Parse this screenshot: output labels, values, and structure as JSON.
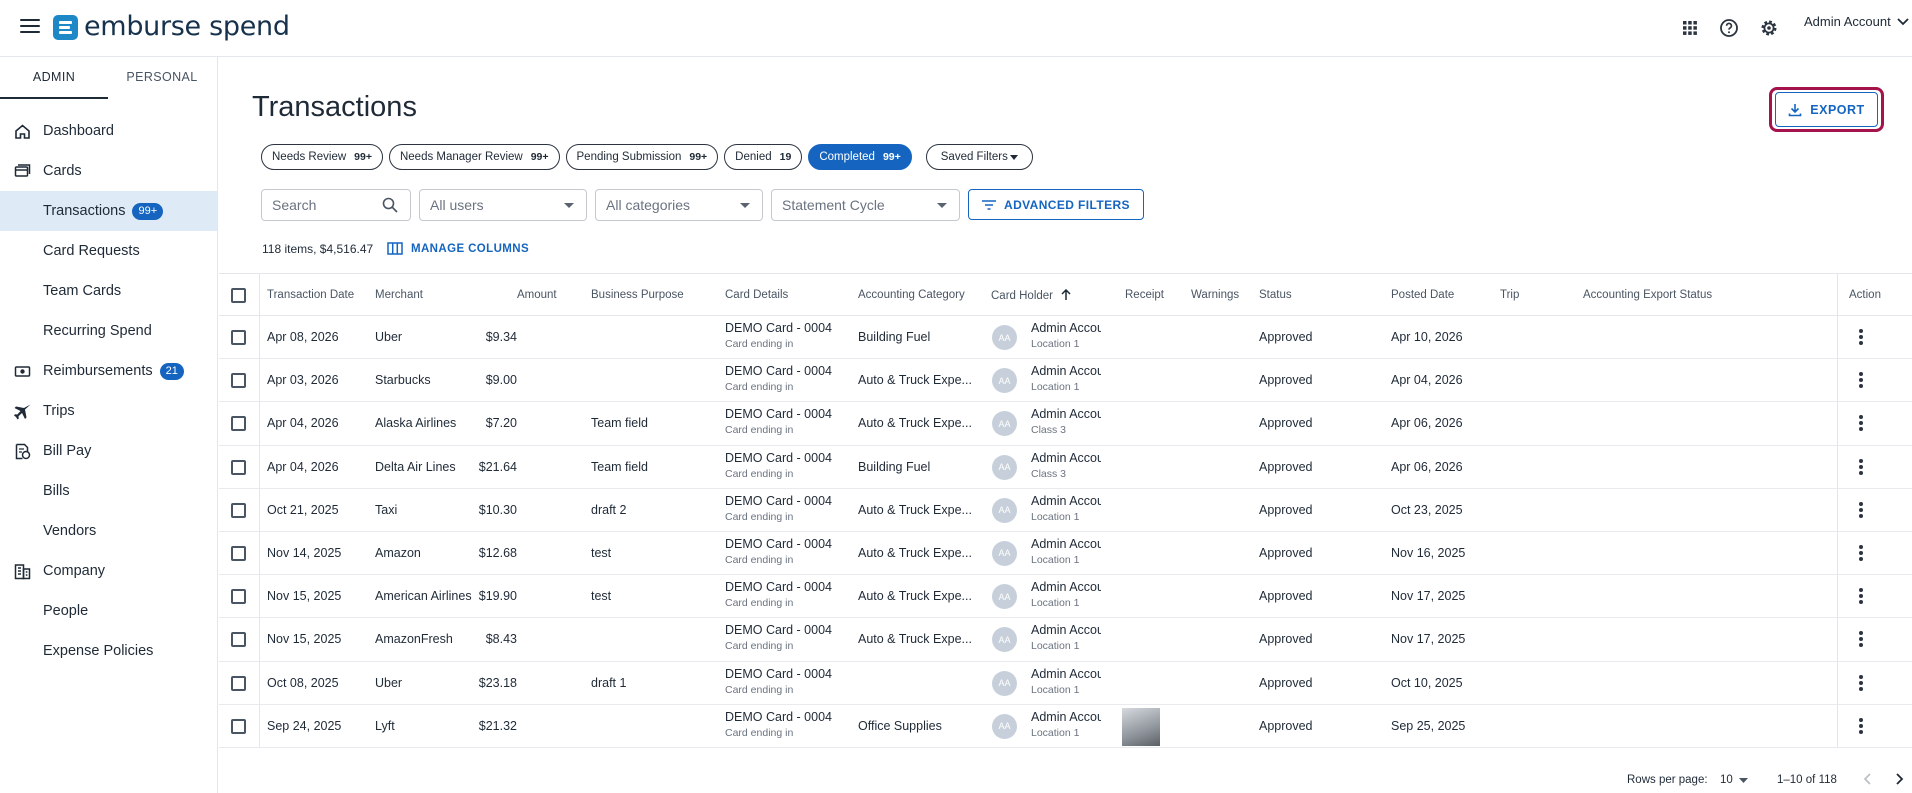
{
  "app": {
    "brand": "emburse spend",
    "account": "Admin Account"
  },
  "sidebar": {
    "tabs": [
      "ADMIN",
      "PERSONAL"
    ],
    "items": [
      {
        "label": "Dashboard",
        "icon": "home-icon"
      },
      {
        "label": "Cards",
        "icon": "cards-icon"
      },
      {
        "label": "Transactions",
        "badge": "99+"
      },
      {
        "label": "Card Requests"
      },
      {
        "label": "Team Cards"
      },
      {
        "label": "Recurring Spend"
      },
      {
        "label": "Reimbursements",
        "icon": "reimbursements-icon",
        "badge": "21"
      },
      {
        "label": "Trips",
        "icon": "plane-icon"
      },
      {
        "label": "Bill Pay",
        "icon": "bill-pay-icon"
      },
      {
        "label": "Bills"
      },
      {
        "label": "Vendors"
      },
      {
        "label": "Company",
        "icon": "company-icon"
      },
      {
        "label": "People"
      },
      {
        "label": "Expense Policies"
      }
    ]
  },
  "page": {
    "title": "Transactions",
    "export_label": "EXPORT",
    "chips": [
      {
        "label": "Needs Review",
        "count": "99+"
      },
      {
        "label": "Needs Manager Review",
        "count": "99+"
      },
      {
        "label": "Pending Submission",
        "count": "99+"
      },
      {
        "label": "Denied",
        "count": "19"
      },
      {
        "label": "Completed",
        "count": "99+"
      }
    ],
    "saved_filters": "Saved Filters",
    "filters": {
      "search_placeholder": "Search",
      "users": "All users",
      "categories": "All categories",
      "cycle": "Statement Cycle",
      "advanced": "ADVANCED FILTERS"
    },
    "summary": "118 items, $4,516.47",
    "manage_columns": "MANAGE COLUMNS"
  },
  "table": {
    "columns": [
      "Transaction Date",
      "Merchant",
      "Amount",
      "Business Purpose",
      "Card Details",
      "Accounting Category",
      "Card Holder",
      "Receipt",
      "Warnings",
      "Status",
      "Posted Date",
      "Trip",
      "Accounting Export Status",
      "Action"
    ],
    "rows": [
      {
        "date": "Apr 08, 2026",
        "merchant": "Uber",
        "amount": "$9.34",
        "purpose": "",
        "card": "DEMO Card - 0004",
        "card_sub": "Card ending in",
        "category": "Building Fuel",
        "holder": "Admin Accour",
        "holder_sub": "Location 1",
        "status": "Approved",
        "posted": "Apr 10, 2026"
      },
      {
        "date": "Apr 03, 2026",
        "merchant": "Starbucks",
        "amount": "$9.00",
        "purpose": "",
        "card": "DEMO Card - 0004",
        "card_sub": "Card ending in",
        "category": "Auto & Truck Expe...",
        "holder": "Admin Accour",
        "holder_sub": "Location 1",
        "status": "Approved",
        "posted": "Apr 04, 2026"
      },
      {
        "date": "Apr 04, 2026",
        "merchant": "Alaska Airlines",
        "amount": "$7.20",
        "purpose": "Team field",
        "card": "DEMO Card - 0004",
        "card_sub": "Card ending in",
        "category": "Auto & Truck Expe...",
        "holder": "Admin Accour",
        "holder_sub": "Class 3",
        "status": "Approved",
        "posted": "Apr 06, 2026"
      },
      {
        "date": "Apr 04, 2026",
        "merchant": "Delta Air Lines",
        "amount": "$21.64",
        "purpose": "Team field",
        "card": "DEMO Card - 0004",
        "card_sub": "Card ending in",
        "category": "Building Fuel",
        "holder": "Admin Accour",
        "holder_sub": "Class 3",
        "status": "Approved",
        "posted": "Apr 06, 2026"
      },
      {
        "date": "Oct 21, 2025",
        "merchant": "Taxi",
        "amount": "$10.30",
        "purpose": "draft 2",
        "card": "DEMO Card - 0004",
        "card_sub": "Card ending in",
        "category": "Auto & Truck Expe...",
        "holder": "Admin Accour",
        "holder_sub": "Location 1",
        "status": "Approved",
        "posted": "Oct 23, 2025"
      },
      {
        "date": "Nov 14, 2025",
        "merchant": "Amazon",
        "amount": "$12.68",
        "purpose": "test",
        "card": "DEMO Card - 0004",
        "card_sub": "Card ending in",
        "category": "Auto & Truck Expe...",
        "holder": "Admin Accour",
        "holder_sub": "Location 1",
        "status": "Approved",
        "posted": "Nov 16, 2025"
      },
      {
        "date": "Nov 15, 2025",
        "merchant": "American Airlines",
        "amount": "$19.90",
        "purpose": "test",
        "card": "DEMO Card - 0004",
        "card_sub": "Card ending in",
        "category": "Auto & Truck Expe...",
        "holder": "Admin Accour",
        "holder_sub": "Location 1",
        "status": "Approved",
        "posted": "Nov 17, 2025"
      },
      {
        "date": "Nov 15, 2025",
        "merchant": "AmazonFresh",
        "amount": "$8.43",
        "purpose": "",
        "card": "DEMO Card - 0004",
        "card_sub": "Card ending in",
        "category": "Auto & Truck Expe...",
        "holder": "Admin Accour",
        "holder_sub": "Location 1",
        "status": "Approved",
        "posted": "Nov 17, 2025"
      },
      {
        "date": "Oct 08, 2025",
        "merchant": "Uber",
        "amount": "$23.18",
        "purpose": "draft 1",
        "card": "DEMO Card - 0004",
        "card_sub": "Card ending in",
        "category": "",
        "holder": "Admin Accour",
        "holder_sub": "Location 1",
        "status": "Approved",
        "posted": "Oct 10, 2025"
      },
      {
        "date": "Sep 24, 2025",
        "merchant": "Lyft",
        "amount": "$21.32",
        "purpose": "",
        "card": "DEMO Card - 0004",
        "card_sub": "Card ending in",
        "category": "Office Supplies",
        "holder": "Admin Accour",
        "holder_sub": "Location 1",
        "status": "Approved",
        "posted": "Sep 25, 2025",
        "receipt": true
      }
    ],
    "avatar_initials": "AA"
  },
  "pagination": {
    "rows_label": "Rows per page:",
    "rows_value": "10",
    "range": "1–10 of 118"
  },
  "colors": {
    "accent": "#1565c0",
    "active_nav_bg": "#deeaf5",
    "highlight_ring": "#a4134c"
  }
}
